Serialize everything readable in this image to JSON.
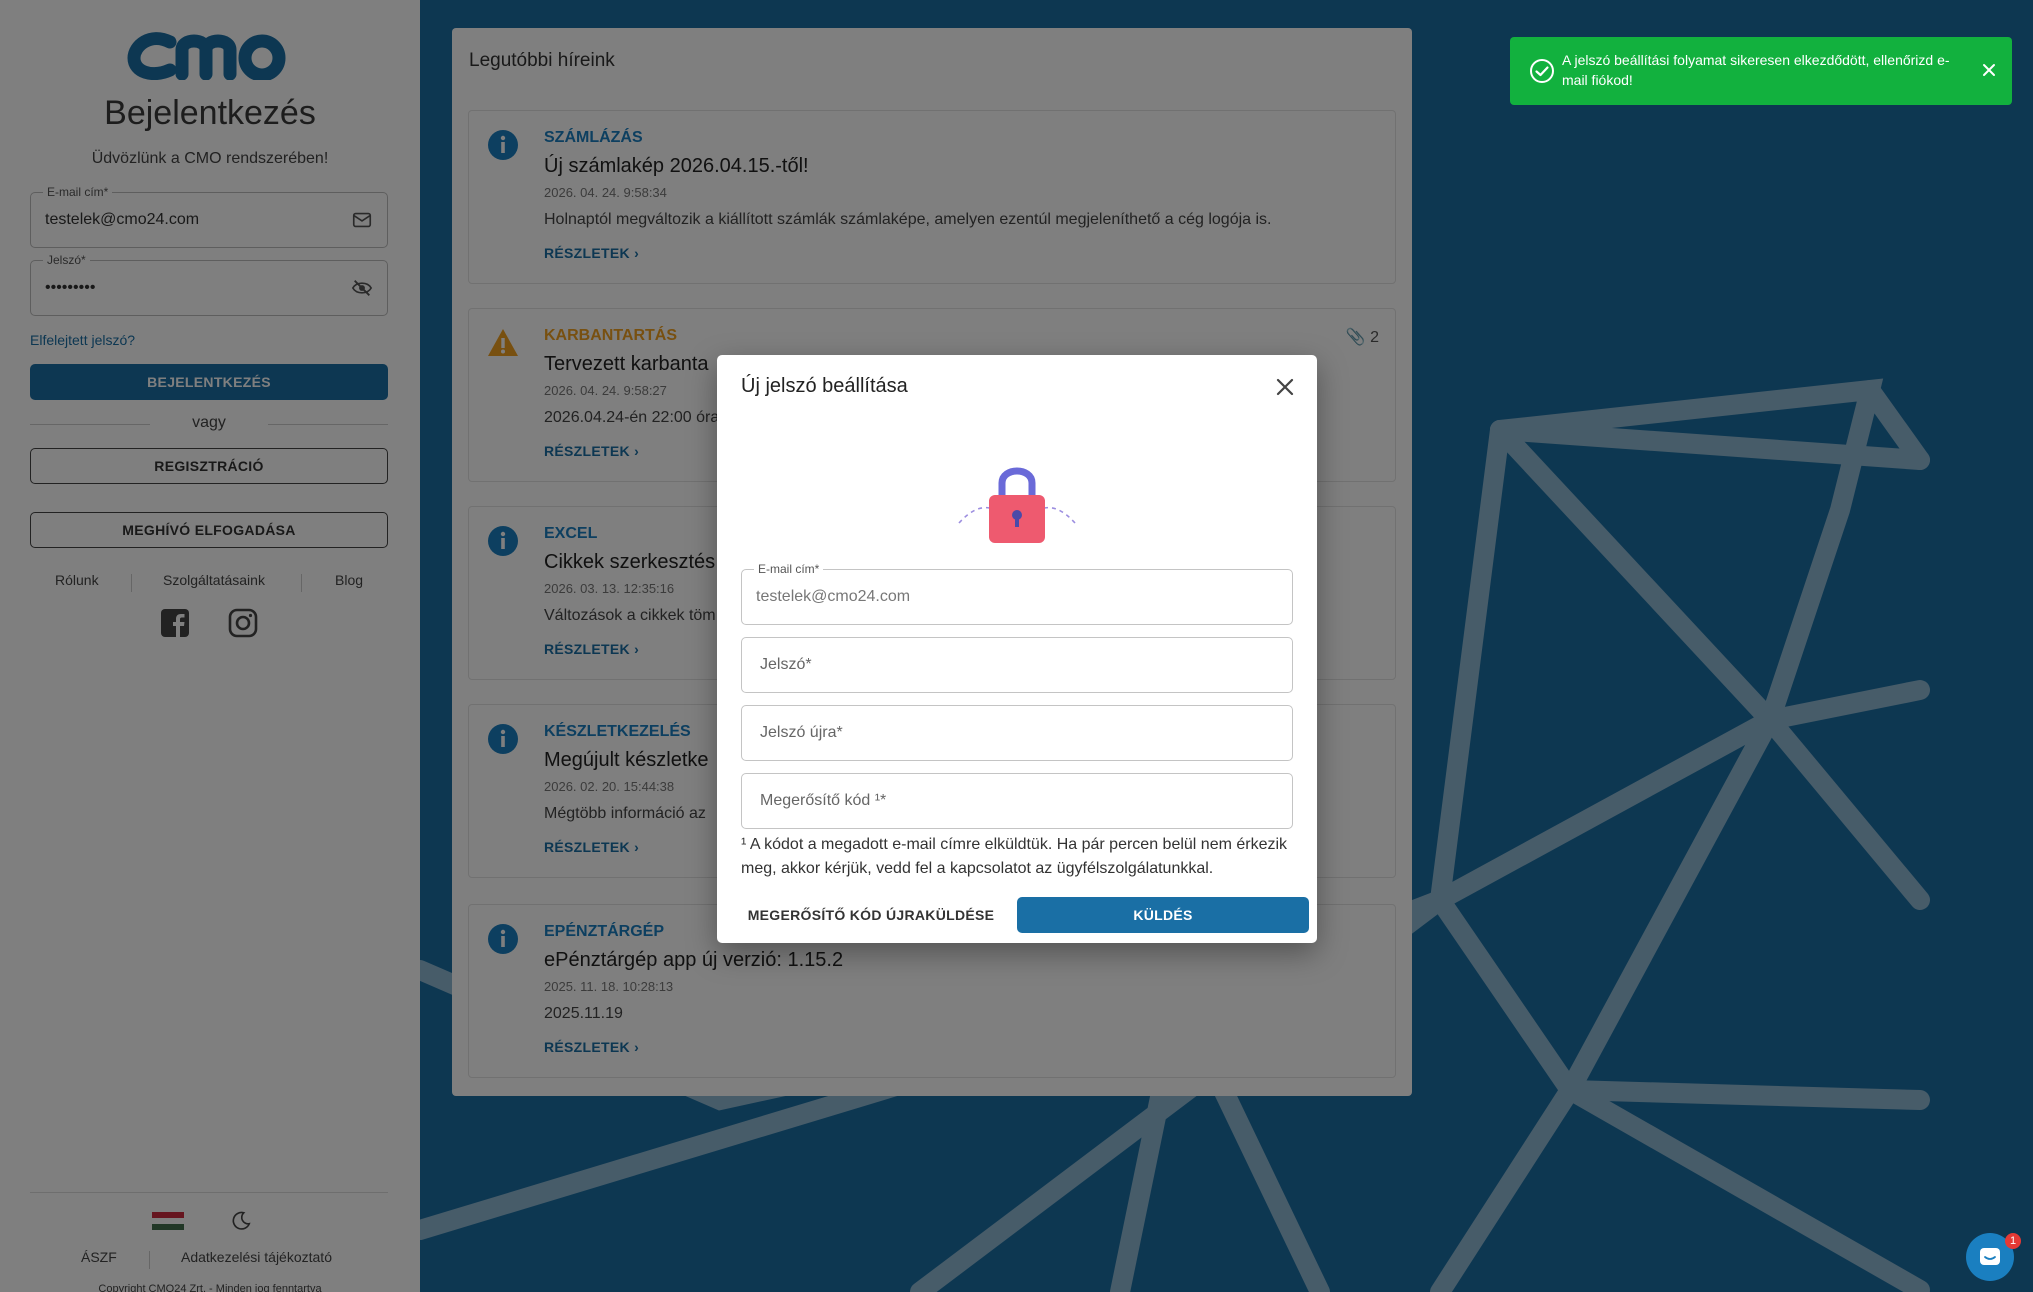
{
  "colors": {
    "brand": "#1a6fa5",
    "success": "#12b13e",
    "warning": "#f0a020",
    "info": "#1a7fc0"
  },
  "login": {
    "title": "Bejelentkezés",
    "welcome": "Üdvözlünk a CMO rendszerében!",
    "email_label": "E-mail cím*",
    "email_value": "testelek@cmo24.com",
    "password_label": "Jelszó*",
    "password_value": "•••••••••",
    "forgot": "Elfelejtett jelszó?",
    "login_button": "BEJELENTKEZÉS",
    "or": "vagy",
    "register_button": "REGISZTRÁCIÓ",
    "invite_button": "MEGHÍVÓ ELFOGADÁSA",
    "links": [
      "Rólunk",
      "Szolgáltatásaink",
      "Blog"
    ],
    "footer_links": [
      "ÁSZF",
      "Adatkezelési tájékoztató"
    ],
    "copyright": "Copyright CMO24 Zrt. - Minden jog fenntartva"
  },
  "news": {
    "title": "Legutóbbi híreink",
    "more_label": "RÉSZLETEK",
    "items": [
      {
        "icon": "info-icon",
        "category": "SZÁMLÁZÁS",
        "headline": "Új számlakép 2026.04.15.-től!",
        "date": "2026. 04. 24. 9:58:34",
        "description": "Holnaptól megváltozik a kiállított számlák számlaképe, amelyen ezentúl megjeleníthető a cég logója is.",
        "attachments": ""
      },
      {
        "icon": "warning-icon",
        "category": "KARBANTARTÁS",
        "headline": "Tervezett karbanta",
        "date": "2026. 04. 24. 9:58:27",
        "description": "2026.04.24-én 22:00 óra",
        "attachments": "2"
      },
      {
        "icon": "info-icon",
        "category": "EXCEL",
        "headline": "Cikkek szerkesztés",
        "date": "2026. 03. 13. 12:35:16",
        "description": "Változások a cikkek töm",
        "attachments": ""
      },
      {
        "icon": "info-icon",
        "category": "KÉSZLETKEZELÉS",
        "headline": "Megújult készletke",
        "date": "2026. 02. 20. 15:44:38",
        "description": "Mégtöbb információ az",
        "attachments": ""
      },
      {
        "icon": "info-icon",
        "category": "EPÉNZTÁRGÉP",
        "headline": "ePénztárgép app új verzió: 1.15.2",
        "date": "2025. 11. 18. 10:28:13",
        "description": "2025.11.19",
        "attachments": ""
      }
    ]
  },
  "modal": {
    "title": "Új jelszó beállítása",
    "email_label": "E-mail cím*",
    "email_value": "testelek@cmo24.com",
    "password_placeholder": "Jelszó*",
    "password_again_placeholder": "Jelszó újra*",
    "code_placeholder": "Megerősítő kód ¹*",
    "note": "¹ A kódot a megadott e-mail címre elküldtük. Ha pár percen belül nem érkezik meg, akkor kérjük, vedd fel a kapcsolatot az ügyfélszolgálatunkkal.",
    "resend_button": "MEGERŐSÍTŐ KÓD ÚJRAKÜLDÉSE",
    "send_button": "KÜLDÉS"
  },
  "toast": {
    "message": "A jelszó beállítási folyamat sikeresen elkezdődött, ellenőrizd e-mail fiókod!"
  },
  "chat": {
    "badge": "1"
  }
}
